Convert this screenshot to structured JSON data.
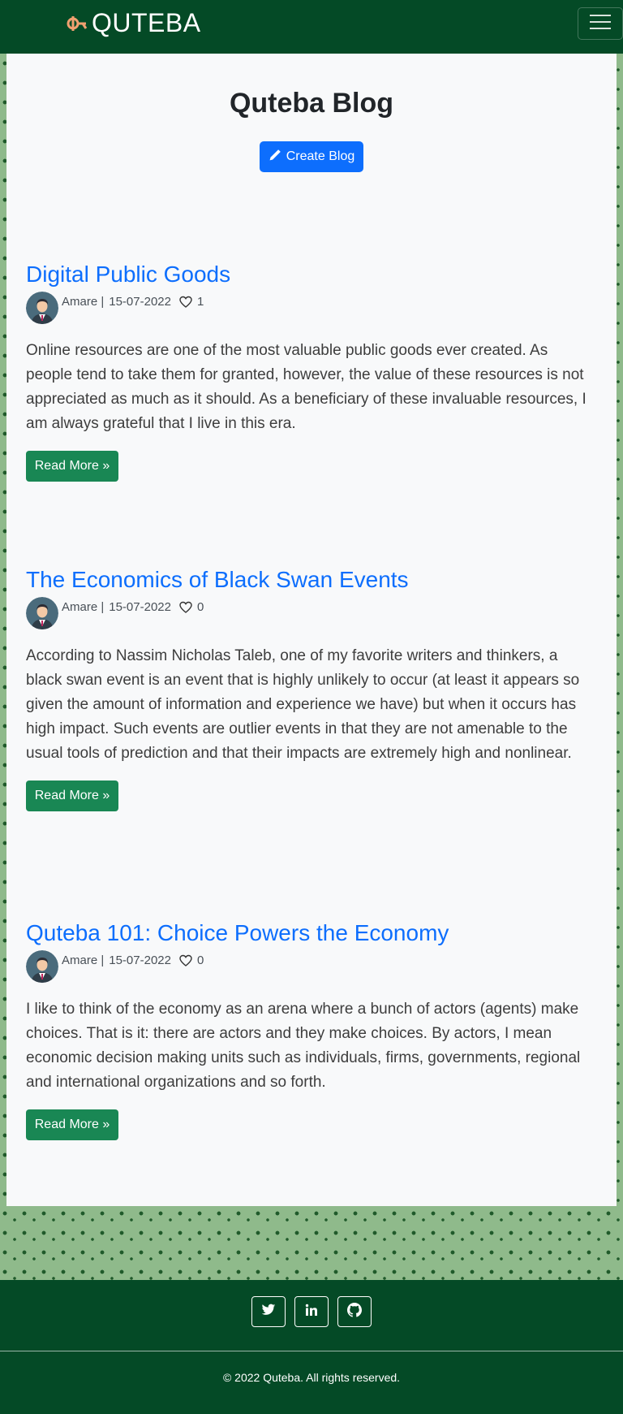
{
  "navbar": {
    "brand_text": "QUTEBA",
    "brand_icon": "quteba-logo-icon",
    "menu_icon": "hamburger-menu-icon"
  },
  "page": {
    "title": "Quteba Blog",
    "create_button_label": "Create Blog",
    "create_button_icon": "pencil-icon"
  },
  "posts": [
    {
      "title": "Digital Public Goods",
      "author": "Amare |",
      "date": "15-07-2022",
      "likes": "1",
      "excerpt": "Online resources are one of the most valuable public goods ever created. As people tend to take them for granted, however, the value of these resources is not appreciated as much as it should. As a beneficiary of these invaluable resources, I am always grateful that I live in this era.",
      "read_more_label": "Read More »"
    },
    {
      "title": "The Economics of Black Swan Events",
      "author": "Amare |",
      "date": "15-07-2022",
      "likes": "0",
      "excerpt": "According to Nassim Nicholas Taleb, one of my favorite writers and thinkers, a black swan event is an event that is highly unlikely to occur (at least it appears so given the amount of information and experience we have) but when it occurs has high impact. Such events are outlier events in that they are not amenable to the usual tools of prediction and that their impacts are extremely high and nonlinear.",
      "read_more_label": "Read More »"
    },
    {
      "title": "Quteba 101: Choice Powers the Economy",
      "author": "Amare |",
      "date": "15-07-2022",
      "likes": "0",
      "excerpt": "I like to think of the economy as an arena where a bunch of actors (agents) make choices. That is it: there are actors and they make choices. By actors, I mean economic decision making units such as individuals, firms, governments, regional and international organizations and so forth.",
      "read_more_label": "Read More »"
    }
  ],
  "footer": {
    "social_icons": [
      "twitter-icon",
      "linkedin-icon",
      "github-icon"
    ],
    "copyright": "2022 Quteba. All rights reserved."
  },
  "colors": {
    "navbar": "#044a26",
    "link_blue": "#0d6efd",
    "read_more_green": "#198754",
    "pattern_bg": "#8fba8b"
  }
}
